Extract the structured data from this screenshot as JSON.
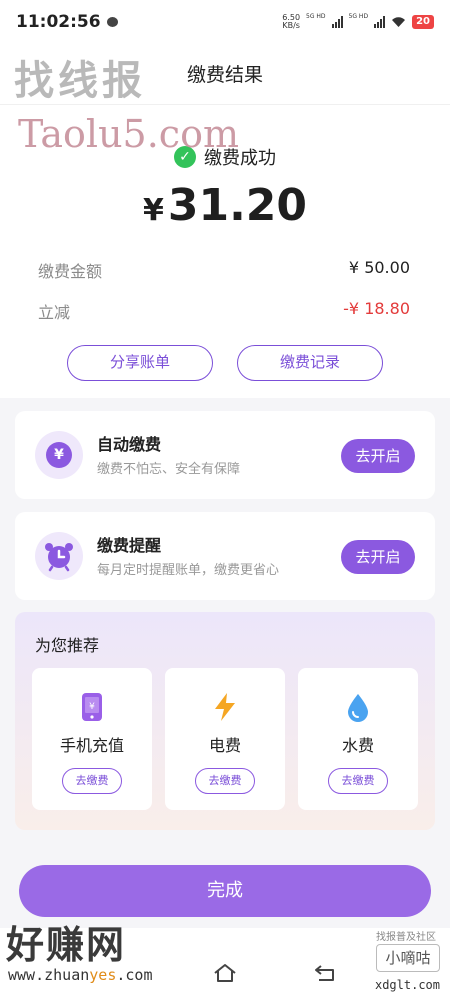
{
  "status": {
    "time": "11:02:56",
    "net_speed": "6.50",
    "net_unit": "KB/s",
    "sim1": "5G HD",
    "sim2": "5G HD",
    "battery": "20"
  },
  "watermarks": {
    "top": "找线报",
    "taolu": "Taolu5.com",
    "bottom_big": "好赚网",
    "bottom_url_a": "www.zhuan",
    "bottom_url_b": "yes",
    "bottom_url_c": ".com",
    "right_caption": "找报普及社区",
    "right_box": "小嘀咕",
    "right_url": "xdglt.com"
  },
  "header": {
    "title": "缴费结果"
  },
  "result": {
    "status_text": "缴费成功",
    "currency": "¥",
    "amount": "31.20"
  },
  "details": [
    {
      "label": "缴费金额",
      "value": "¥ 50.00"
    },
    {
      "label": "立减",
      "value": "-¥ 18.80"
    }
  ],
  "actions": {
    "share": "分享账单",
    "records": "缴费记录"
  },
  "cards": [
    {
      "title": "自动缴费",
      "desc": "缴费不怕忘、安全有保障",
      "button": "去开启",
      "icon": "yen-icon"
    },
    {
      "title": "缴费提醒",
      "desc": "每月定时提醒账单，缴费更省心",
      "button": "去开启",
      "icon": "alarm-clock-icon"
    }
  ],
  "recommend": {
    "title": "为您推荐",
    "items": [
      {
        "label": "手机充值",
        "button": "去缴费",
        "icon": "phone-icon"
      },
      {
        "label": "电费",
        "button": "去缴费",
        "icon": "lightning-icon"
      },
      {
        "label": "水费",
        "button": "去缴费",
        "icon": "water-drop-icon"
      }
    ]
  },
  "done_button": "完成",
  "colors": {
    "accent": "#8b59e0",
    "success": "#33c35a",
    "discount": "#e33b3b"
  }
}
